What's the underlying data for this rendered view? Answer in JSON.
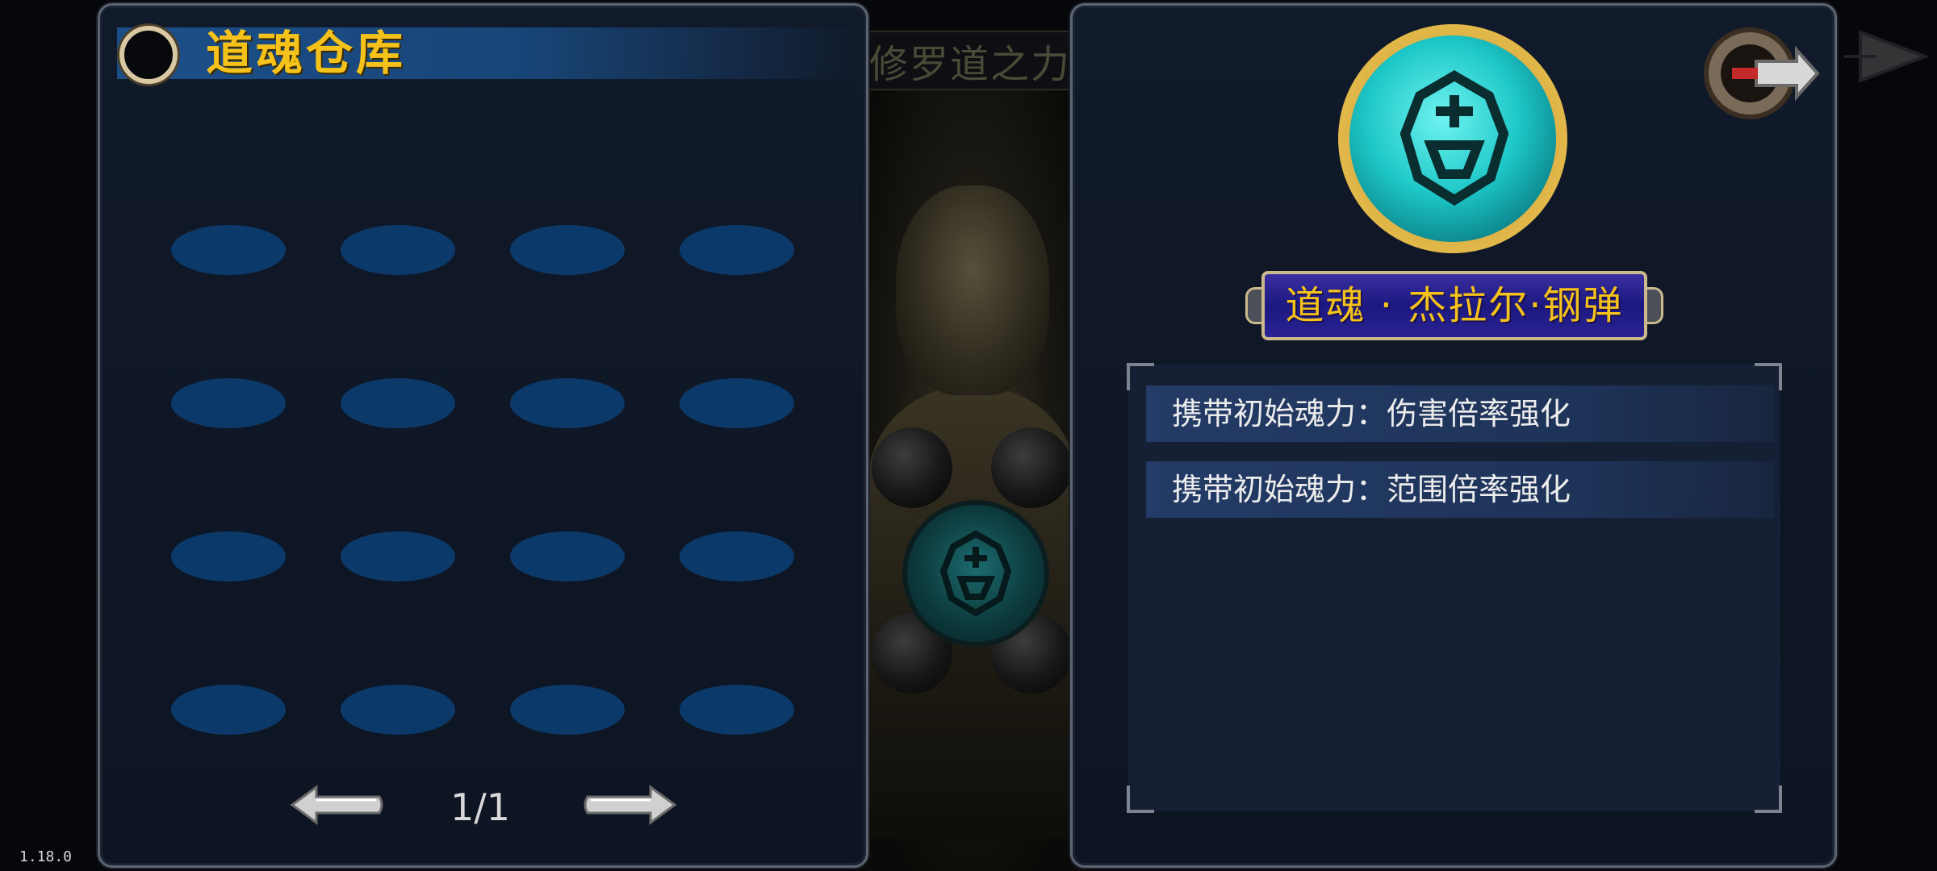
{
  "background": {
    "title": "修罗道之力"
  },
  "storage_panel": {
    "title": "道魂仓库",
    "slot_rows": 4,
    "slot_cols": 4,
    "page_indicator": "1/1",
    "prev_icon": "arrow-left-icon",
    "next_icon": "arrow-right-icon"
  },
  "detail_panel": {
    "soul_name": "道魂 · 杰拉尔·钢弹",
    "attributes": [
      "携带初始魂力：伤害倍率强化",
      "携带初始魂力：范围倍率强化"
    ],
    "close_icon": "back-close-icon"
  },
  "version": "1.18.0",
  "colors": {
    "gold_text": "#f4c21a",
    "panel_bg": "#111a2a",
    "slot_blue": "#0b3a6a",
    "soul_cyan": "#1ec8c8"
  }
}
